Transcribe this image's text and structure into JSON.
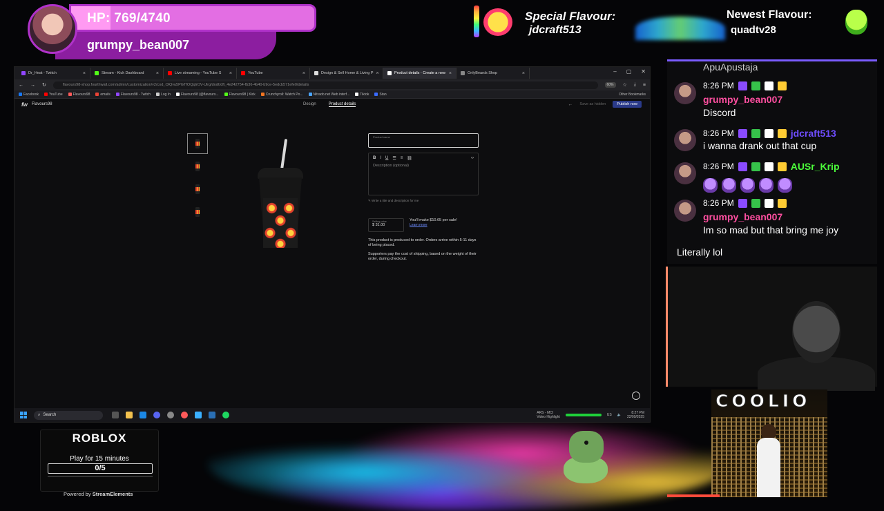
{
  "overlay": {
    "hp_text": "HP: 769/4740",
    "hp_username": "grumpy_bean007",
    "hp_fraction": 0.162,
    "special_label": "Special Flavour:",
    "special_user": "jdcraft513",
    "newest_label": "Newest Flavour:",
    "newest_user": "quadtv28"
  },
  "browser": {
    "tabs": [
      {
        "label": "Dr_Heat - Twitch",
        "color": "#9146ff"
      },
      {
        "label": "Stream - Kick Dashboard",
        "color": "#53fc18"
      },
      {
        "label": "Live streaming - YouTube S",
        "color": "#ff0000"
      },
      {
        "label": "YouTube",
        "color": "#ff0000"
      },
      {
        "label": "Design & Sell Home & Living P",
        "color": "#dddddd"
      },
      {
        "label": "Product details - Create a new",
        "color": "#ffffff",
        "active": true
      },
      {
        "label": "OnlyBeards Shop",
        "color": "#888888"
      }
    ],
    "url": "flavours98-shop.fourthwall.com/admin/customization/v2/cod_OlQvu5PGTfOQqlrOV-Ulrg/draft/dft_4e242754-fb36-4b40-b9ce-5edcb571efe0/details",
    "zoom": "60%",
    "bookmarks": [
      {
        "label": "Facebook",
        "color": "#1877f2"
      },
      {
        "label": "YouTube",
        "color": "#ff0000"
      },
      {
        "label": "Flavours98",
        "color": "#ff5a5a"
      },
      {
        "label": "emails",
        "color": "#ea4335"
      },
      {
        "label": "Flavours98 - Twitch",
        "color": "#9146ff"
      },
      {
        "label": "Log In",
        "color": "#cccccc"
      },
      {
        "label": "Flavours98 (@flavours...",
        "color": "#ffffff"
      },
      {
        "label": "Flavours98 | Kick",
        "color": "#53fc18"
      },
      {
        "label": "Crunchyroll: Watch Po...",
        "color": "#f47521"
      },
      {
        "label": "Nitrado.net Web interf...",
        "color": "#4aa3ff"
      },
      {
        "label": "Tiktok",
        "color": "#ffffff"
      },
      {
        "label": "Stan",
        "color": "#3a6bff"
      }
    ],
    "other_bookmarks": "Other Bookmarks"
  },
  "app": {
    "brand": "Flavours98",
    "tab_design": "Design",
    "tab_product_details": "Product details",
    "save_hidden": "Save as hidden",
    "publish": "Publish now",
    "product_name_label": "Product name",
    "description_placeholder": "Description (optional)",
    "ai_hint": "Write a title and description for me",
    "selling_price_label": "Selling price",
    "selling_price": "$ 31.00",
    "earnings": "You'll make $10.65 per sale!",
    "learn_more": "Learn more",
    "note_1": "This product is produced to order. Orders arrive within 5-11 days of being placed.",
    "note_2": "Supporters pay the cost of shipping, based on the weight of their order, during checkout."
  },
  "taskbar": {
    "search": "Search",
    "tray_audio": "ARS - MCI",
    "tray_audio_sub": "Video Highlight",
    "lang": "US",
    "time": "8:27 PM",
    "date": "22/09/2025"
  },
  "chat": {
    "partial_top": "ApuApustaja",
    "messages": [
      {
        "time": "8:26 PM",
        "name": "grumpy_bean007",
        "name_color": "#ff4fa0",
        "text": "Discord"
      },
      {
        "time": "8:26 PM",
        "name": "jdcraft513",
        "name_color": "#6f4dff",
        "text": "i wanna drank out that cup"
      },
      {
        "time": "8:26 PM",
        "name": "AUSr_Krip",
        "name_color": "#4cff3a",
        "text": ""
      },
      {
        "time": "8:26 PM",
        "name": "grumpy_bean007",
        "name_color": "#ff4fa0",
        "text": "Im so mad but that bring me joy"
      }
    ],
    "last_line": "Literally lol"
  },
  "video": {
    "title": "COOLIO"
  },
  "roblox": {
    "logo": "ROBLOX",
    "play_text": "Play for 15 minutes",
    "counter": "0/5",
    "progress_fraction": 0.0,
    "powered_by": "Powered by",
    "powered_brand": "StreamElements"
  }
}
